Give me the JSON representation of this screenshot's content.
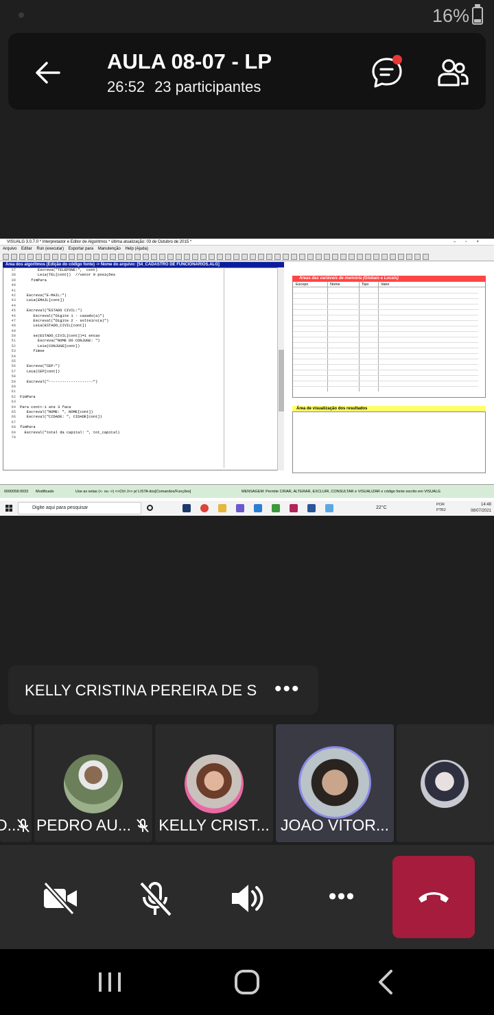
{
  "status_bar": {
    "battery": "16%"
  },
  "meeting": {
    "title": "AULA 08-07 - LP",
    "duration": "26:52",
    "participants": "23 participantes"
  },
  "shared_screen": {
    "window_title": "VISUALG 3.0.7.0 * Interpretador e Editor de Algoritmos * última atualização: 03 de Outubro de 2015 *",
    "menu": [
      "Arquivo",
      "Editar",
      "Run (executar)",
      "Exportar para",
      "Manutenção",
      "Help (Ajuda)"
    ],
    "editor_header": "Área dos algoritmos (Edição do código fonte) -> Nome do arquivo: [54_CADASTRO DE FUNCIONARIOS.ALG]",
    "code_lines": [
      {
        "n": "37",
        "code": "        Escreva(\"TELEFONE:\",  cont)"
      },
      {
        "n": "38",
        "code": "        Leia(TEL[cont])  //vetor 9 posições"
      },
      {
        "n": "39",
        "code": "     fimPara"
      },
      {
        "n": "40",
        "code": ""
      },
      {
        "n": "41",
        "code": ""
      },
      {
        "n": "42",
        "code": "   Escreva(\"E-MAIL:\")"
      },
      {
        "n": "43",
        "code": "   Leia(EMAIL[cont])"
      },
      {
        "n": "44",
        "code": ""
      },
      {
        "n": "45",
        "code": "   Escreval(\"ESTADO CIVIL:\")"
      },
      {
        "n": "46",
        "code": "      Escreval(\"Digite 1 - casado(a)\")"
      },
      {
        "n": "47",
        "code": "      Escreval(\"Digite 2 - solteiro(a)\")"
      },
      {
        "n": "48",
        "code": "      Leia(ESTADO_CIVIL[cont])"
      },
      {
        "n": "49",
        "code": ""
      },
      {
        "n": "50",
        "code": "      se(ESTADO_CIVIL[cont])=1 entao"
      },
      {
        "n": "51",
        "code": "        Escreva(\"NOME DO CONJUGE: \")"
      },
      {
        "n": "52",
        "code": "        Leia(CONJUGE[cont])"
      },
      {
        "n": "53",
        "code": "      fimse"
      },
      {
        "n": "54",
        "code": ""
      },
      {
        "n": "55",
        "code": ""
      },
      {
        "n": "56",
        "code": "   Escreva(\"CEP:\")"
      },
      {
        "n": "57",
        "code": "   Leia(CEP[cont])"
      },
      {
        "n": "58",
        "code": ""
      },
      {
        "n": "59",
        "code": "   Escreval(\"--------------------\")"
      },
      {
        "n": "60",
        "code": ""
      },
      {
        "n": "61",
        "code": ""
      },
      {
        "n": "62",
        "code": "FimPara"
      },
      {
        "n": "63",
        "code": ""
      },
      {
        "n": "64",
        "code": "Para cont<-1 ate 3 faca"
      },
      {
        "n": "65",
        "code": "   Escreval(\"NOME: \", NOME[cont])"
      },
      {
        "n": "66",
        "code": "   Escreval(\"CIDADE: \", CIDADE[cont])"
      },
      {
        "n": "67",
        "code": ""
      },
      {
        "n": "68",
        "code": "fimPara"
      },
      {
        "n": "69",
        "code": "  Escreval(\"total da capital: \", tot_capital)"
      },
      {
        "n": "70",
        "code": ""
      }
    ],
    "vars_header": "Áreas das variáveis de memória (Globais e Locais)",
    "vars_columns": [
      "Escopo",
      "Nome",
      "Tipo",
      "Valor"
    ],
    "output_header": "Área de visualização dos resultados",
    "status": {
      "position": "0000058:0033",
      "state": "Modificado",
      "hint": "Use as setas (<- ou ->) <<Ctrl J>> p/ LISTA dos[Comandos/Funções]",
      "message": "MENSAGEM: Permite CRIAR, ALTERAR, EXCLUIR, CONSULTAR e VISUALIZAR o código fonte escrito em VISUALG"
    },
    "taskbar": {
      "search_placeholder": "Digite aqui para pesquisar",
      "weather": "22°C",
      "lang": "POR",
      "lang2": "PTB2",
      "time": "14:48",
      "date": "08/07/2021"
    }
  },
  "speaker": {
    "name": "KELLY CRISTINA PEREIRA DE S",
    "more": "•••"
  },
  "participants": [
    {
      "name": "D...",
      "muted": true
    },
    {
      "name": "PEDRO AU...",
      "muted": true
    },
    {
      "name": "KELLY CRIST...",
      "muted": false
    },
    {
      "name": "JOAO VITOR...",
      "muted": false,
      "active": true
    },
    {
      "name": "",
      "muted": false
    }
  ],
  "controls": {
    "camera": "camera-off",
    "mic": "mic-off",
    "speaker": "speaker-on",
    "more": "•••",
    "hangup": "hang-up"
  }
}
